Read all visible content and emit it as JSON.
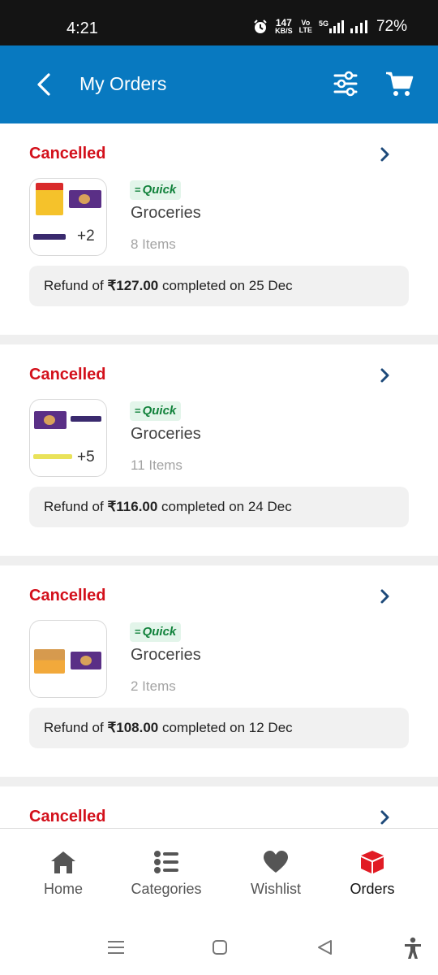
{
  "status_bar": {
    "time": "4:21",
    "net_speed_top": "147",
    "net_speed_bottom": "KB/S",
    "volte_top": "Vo",
    "volte_bottom": "LTE",
    "network": "5G",
    "battery": "72%"
  },
  "app_bar": {
    "title": "My Orders",
    "icons": [
      "back-arrow-icon",
      "filter-sliders-icon",
      "cart-icon"
    ]
  },
  "orders": [
    {
      "status": "Cancelled",
      "badge": "Quick",
      "store": "Groceries",
      "items": "8 Items",
      "more_count": "+2",
      "refund_prefix": "Refund of ",
      "refund_amount": "₹127.00",
      "refund_suffix": " completed on 25 Dec"
    },
    {
      "status": "Cancelled",
      "badge": "Quick",
      "store": "Groceries",
      "items": "11 Items",
      "more_count": "+5",
      "refund_prefix": "Refund of ",
      "refund_amount": "₹116.00",
      "refund_suffix": " completed on 24 Dec"
    },
    {
      "status": "Cancelled",
      "badge": "Quick",
      "store": "Groceries",
      "items": "2 Items",
      "more_count": "",
      "refund_prefix": "Refund of ",
      "refund_amount": "₹108.00",
      "refund_suffix": " completed on 12 Dec"
    },
    {
      "status": "Cancelled"
    }
  ],
  "bottom_nav": {
    "items": [
      {
        "label": "Home",
        "icon": "home-icon"
      },
      {
        "label": "Categories",
        "icon": "categories-icon"
      },
      {
        "label": "Wishlist",
        "icon": "heart-icon"
      },
      {
        "label": "Orders",
        "icon": "box-icon"
      }
    ],
    "active": "Orders"
  },
  "colors": {
    "app_bar": "#0879c0",
    "cancelled": "#d3101b",
    "quick_badge_bg": "#e3f5ea",
    "quick_badge_text": "#12823c",
    "orders_active": "#e11b24"
  }
}
